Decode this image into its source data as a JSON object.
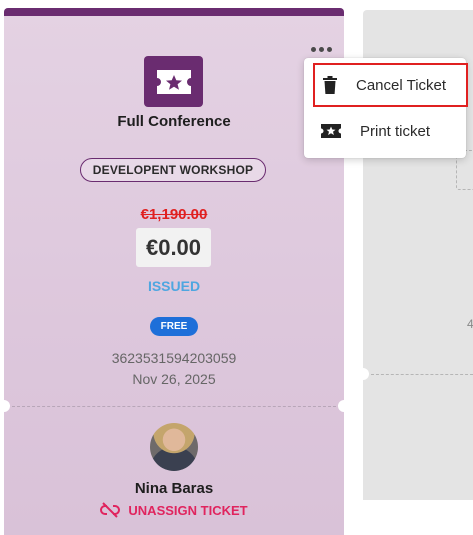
{
  "ticket": {
    "name": "Full Conference",
    "category": "DEVELOPENT WORKSHOP",
    "original_price": "€1,190.00",
    "price": "€0.00",
    "status": "ISSUED",
    "price_badge": "FREE",
    "ticket_number": "3623531594203059",
    "issue_date": "Nov 26, 2025",
    "attendee": {
      "name": "Nina Baras"
    },
    "unassign_label": "UNASSIGN TICKET"
  },
  "menu": {
    "items": [
      {
        "label": "Cancel Ticket",
        "icon": "trash-icon"
      },
      {
        "label": "Print ticket",
        "icon": "ticket-icon"
      }
    ]
  },
  "side_card": {
    "glyph": "4"
  },
  "colors": {
    "brand": "#6a2c70",
    "status": "#4fa6e0",
    "free_badge": "#1e6fd9",
    "danger": "#e02020",
    "unassign": "#e0245e"
  }
}
